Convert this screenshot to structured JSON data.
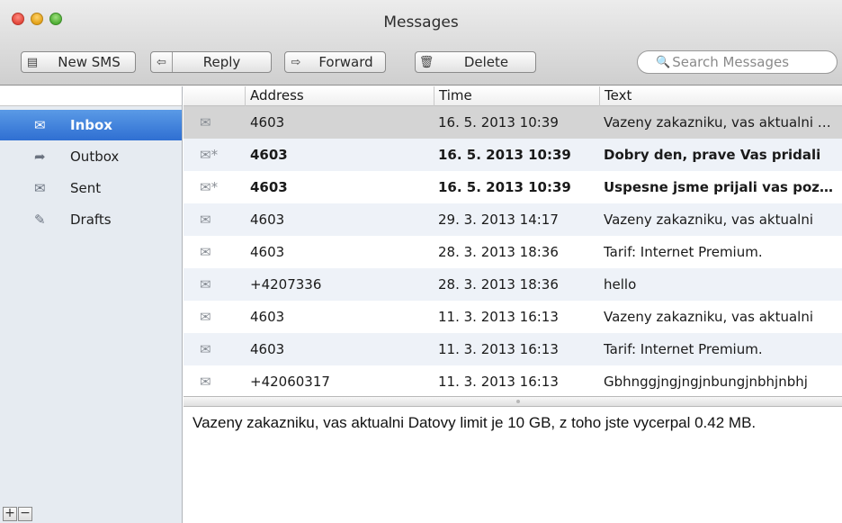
{
  "window": {
    "title": "Messages"
  },
  "toolbar": {
    "new_sms": {
      "label": "New SMS",
      "icon": "compose-icon"
    },
    "reply": {
      "label": "Reply",
      "icon": "reply-arrow-icon"
    },
    "forward": {
      "label": "Forward",
      "icon": "forward-arrow-icon"
    },
    "delete": {
      "label": "Delete",
      "icon": "trash-icon"
    }
  },
  "search": {
    "placeholder": "Search Messages",
    "value": ""
  },
  "sidebar": {
    "items": [
      {
        "label": "Inbox",
        "icon": "envelope-icon",
        "selected": true
      },
      {
        "label": "Outbox",
        "icon": "outbox-arrow-icon",
        "selected": false
      },
      {
        "label": "Sent",
        "icon": "sent-envelope-icon",
        "selected": false
      },
      {
        "label": "Drafts",
        "icon": "pencil-icon",
        "selected": false
      }
    ],
    "add_label": "+",
    "remove_label": "−"
  },
  "table": {
    "headers": {
      "address": "Address",
      "time": "Time",
      "text": "Text"
    },
    "rows": [
      {
        "address": "4603",
        "time": "16. 5. 2013 10:39",
        "text": "Vazeny zakazniku, vas aktualni Datovy limit je 10 GB",
        "unread": false,
        "selected": true,
        "icon": "envelope-icon"
      },
      {
        "address": "4603",
        "time": "16. 5. 2013 10:39",
        "text": "Dobry den, prave Vas pridali",
        "unread": true,
        "selected": false,
        "icon": "new-message-icon"
      },
      {
        "address": "4603",
        "time": "16. 5. 2013 10:39",
        "text": "Uspesne jsme prijali vas pozadavek",
        "unread": true,
        "selected": false,
        "icon": "new-message-icon"
      },
      {
        "address": "4603",
        "time": "29. 3. 2013 14:17",
        "text": "Vazeny zakazniku, vas aktualni",
        "unread": false,
        "selected": false,
        "icon": "envelope-icon"
      },
      {
        "address": "4603",
        "time": "28. 3. 2013 18:36",
        "text": "Tarif: Internet Premium.",
        "unread": false,
        "selected": false,
        "icon": "envelope-icon"
      },
      {
        "address": "+4207336",
        "time": "28. 3. 2013 18:36",
        "text": "hello",
        "unread": false,
        "selected": false,
        "icon": "envelope-icon"
      },
      {
        "address": "4603",
        "time": "11. 3. 2013 16:13",
        "text": "Vazeny zakazniku, vas aktualni",
        "unread": false,
        "selected": false,
        "icon": "envelope-icon"
      },
      {
        "address": "4603",
        "time": "11. 3. 2013 16:13",
        "text": "Tarif: Internet Premium.",
        "unread": false,
        "selected": false,
        "icon": "envelope-icon"
      },
      {
        "address": "+42060317",
        "time": "11. 3. 2013 16:13",
        "text": "Gbhnggjngjngjnbungjnbhjnbhj",
        "unread": false,
        "selected": false,
        "icon": "envelope-icon"
      }
    ]
  },
  "preview": {
    "text": "Vazeny zakazniku, vas aktualni Datovy limit je 10 GB, z toho jste vycerpal 0.42 MB."
  },
  "colors": {
    "selection_blue": "#3b7fdc",
    "selected_row": "#d4d4d4",
    "alt_row": "#eef2f8"
  }
}
